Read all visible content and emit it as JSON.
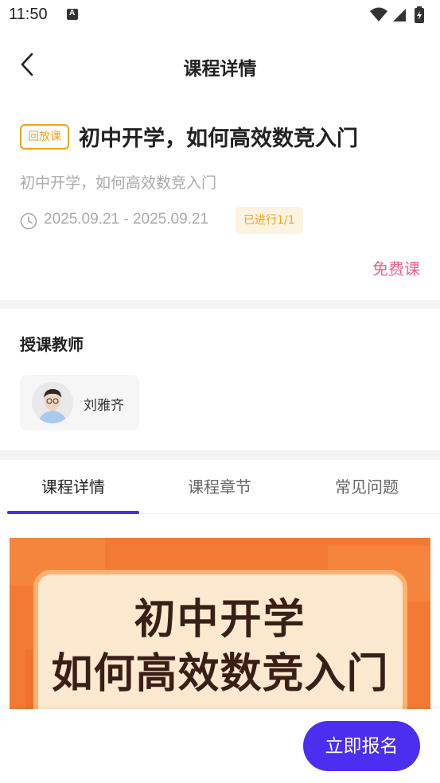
{
  "status_bar": {
    "time": "11:50",
    "notification_letter": "A"
  },
  "nav": {
    "title": "课程详情"
  },
  "course": {
    "replay_tag": "回放课",
    "title": "初中开学，如何高效数竞入门",
    "subtitle": "初中开学，如何高效数竞入门",
    "date_range": "2025.09.21 - 2025.09.21",
    "progress": "已进行1/1",
    "price_label": "免费课"
  },
  "teachers": {
    "heading": "授课教师",
    "items": [
      {
        "name": "刘雅齐"
      }
    ]
  },
  "tabs": [
    {
      "label": "课程详情",
      "active": true
    },
    {
      "label": "课程章节",
      "active": false
    },
    {
      "label": "常见问题",
      "active": false
    }
  ],
  "banner": {
    "line1": "初中开学",
    "line2": "如何高效数竞入门"
  },
  "footer": {
    "signup_label": "立即报名"
  },
  "colors": {
    "accent": "#4a2ff0",
    "tag_orange": "#f7a21b",
    "free_pink": "#f0648a",
    "banner_orange": "#f37a33"
  }
}
